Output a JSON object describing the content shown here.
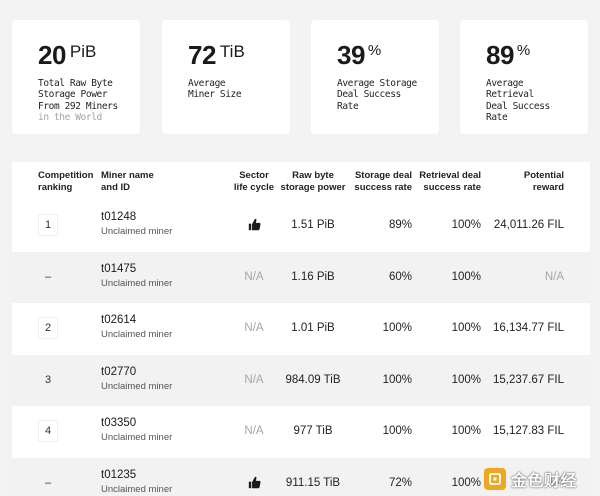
{
  "stats": [
    {
      "value": "20",
      "unit": "PiB",
      "lines": [
        "Total Raw Byte",
        "Storage Power",
        "From 292 Miners"
      ],
      "muted": "in the World"
    },
    {
      "value": "72",
      "unit": "TiB",
      "lines": [
        "Average",
        "Miner Size"
      ],
      "muted": ""
    },
    {
      "value": "39",
      "unit": "%",
      "lines": [
        "Average Storage",
        "Deal Success",
        "Rate"
      ],
      "muted": ""
    },
    {
      "value": "89",
      "unit": "%",
      "lines": [
        "Average",
        "Retrieval",
        "Deal Success",
        "Rate"
      ],
      "muted": ""
    }
  ],
  "table": {
    "headers": {
      "rank": [
        "Competition",
        "ranking"
      ],
      "name": [
        "Miner name",
        "and ID"
      ],
      "sector": [
        "Sector",
        "life cycle"
      ],
      "power": [
        "Raw byte",
        "storage power"
      ],
      "deal": [
        "Storage deal",
        "success rate"
      ],
      "retr": [
        "Retrieval deal",
        "success rate"
      ],
      "reward": [
        "Potential",
        "reward"
      ]
    },
    "rows": [
      {
        "rank": "1",
        "id": "t01248",
        "name": "Unclaimed miner",
        "sector": "thumbs-up-icon",
        "power": "1.51 PiB",
        "deal": "89%",
        "retr": "100%",
        "reward": "24,011.26 FIL"
      },
      {
        "rank": "–",
        "id": "t01475",
        "name": "Unclaimed miner",
        "sector": "N/A",
        "power": "1.16 PiB",
        "deal": "60%",
        "retr": "100%",
        "reward": "N/A"
      },
      {
        "rank": "2",
        "id": "t02614",
        "name": "Unclaimed miner",
        "sector": "N/A",
        "power": "1.01 PiB",
        "deal": "100%",
        "retr": "100%",
        "reward": "16,134.77 FIL"
      },
      {
        "rank": "3",
        "id": "t02770",
        "name": "Unclaimed miner",
        "sector": "N/A",
        "power": "984.09 TiB",
        "deal": "100%",
        "retr": "100%",
        "reward": "15,237.67 FIL"
      },
      {
        "rank": "4",
        "id": "t03350",
        "name": "Unclaimed miner",
        "sector": "N/A",
        "power": "977 TiB",
        "deal": "100%",
        "retr": "100%",
        "reward": "15,127.83 FIL"
      },
      {
        "rank": "–",
        "id": "t01235",
        "name": "Unclaimed miner",
        "sector": "thumbs-up-icon",
        "power": "911.15 TiB",
        "deal": "72%",
        "retr": "100%",
        "reward": "N/A"
      }
    ]
  },
  "watermark": {
    "text": "金色财经",
    "color": "#f0a71f"
  }
}
